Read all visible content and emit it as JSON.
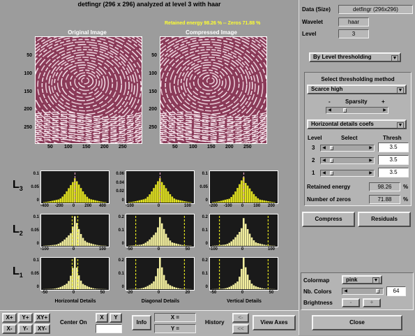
{
  "window": {
    "title": "detfingr (296 x 296) analyzed at level 3 with haar",
    "retained_info": "Retained energy 98.26 % -- Zeros 71.88 %"
  },
  "images": {
    "original_title": "Original Image",
    "compressed_title": "Compressed Image",
    "y_ticks": [
      "50",
      "100",
      "150",
      "200",
      "250"
    ],
    "x_ticks": [
      "50",
      "100",
      "150",
      "200",
      "250"
    ]
  },
  "histograms": {
    "row_labels": [
      {
        "letter": "L",
        "sub": "3"
      },
      {
        "letter": "L",
        "sub": "2"
      },
      {
        "letter": "L",
        "sub": "1"
      }
    ],
    "col_titles": [
      "Horizontal Details",
      "Diagonal Details",
      "Vertical Details"
    ],
    "rows": [
      {
        "cols": [
          {
            "yticks": [
              "0.1",
              "0.05",
              "0"
            ],
            "xticks": [
              "-400",
              "-200",
              "0",
              "200",
              "400"
            ],
            "color": "#e0e020"
          },
          {
            "yticks": [
              "0.06",
              "0.04",
              "0.02",
              "0"
            ],
            "xticks": [
              "-100",
              "0",
              "100"
            ],
            "color": "#e0e020"
          },
          {
            "yticks": [
              "0.1",
              "0.05",
              "0"
            ],
            "xticks": [
              "-200",
              "-100",
              "0",
              "100",
              "200"
            ],
            "color": "#e0e020"
          }
        ]
      },
      {
        "cols": [
          {
            "yticks": [
              "0.1",
              "0.05",
              "0"
            ],
            "xticks": [
              "-100",
              "0",
              "100"
            ],
            "color": "#f4f0a0"
          },
          {
            "yticks": [
              "0.2",
              "0.1",
              "0"
            ],
            "xticks": [
              "-50",
              "0",
              "50"
            ],
            "color": "#f4f0a0"
          },
          {
            "yticks": [
              "0.2",
              "0.1",
              "0"
            ],
            "xticks": [
              "-100",
              "0",
              "100"
            ],
            "color": "#f4f0a0"
          }
        ]
      },
      {
        "cols": [
          {
            "yticks": [
              "0.1",
              "0.05",
              "0"
            ],
            "xticks": [
              "-50",
              "0",
              "50"
            ],
            "color": "#f4f0a0"
          },
          {
            "yticks": [
              "0.2",
              "0.1",
              "0"
            ],
            "xticks": [
              "-20",
              "0",
              "20"
            ],
            "color": "#f4f0a0"
          },
          {
            "yticks": [
              "0.2",
              "0.1",
              "0"
            ],
            "xticks": [
              "-50",
              "0",
              "50"
            ],
            "color": "#f4f0a0"
          }
        ]
      }
    ]
  },
  "right_panel": {
    "data_label": "Data  (Size)",
    "data_value": "detfingr  (296x296)",
    "wavelet_label": "Wavelet",
    "wavelet_value": "haar",
    "level_label": "Level",
    "level_value": "3",
    "threshold_mode": "By Level thresholding",
    "select_method_title": "Select thresholding method",
    "method_value": "Scarce high",
    "sparsity_minus": "-",
    "sparsity_label": "Sparsity",
    "sparsity_plus": "+",
    "details_value": "Horizontal details coefs",
    "col_level": "Level",
    "col_select": "Select",
    "col_thresh": "Thresh",
    "levels": [
      {
        "level": "3",
        "thresh": "3.5"
      },
      {
        "level": "2",
        "thresh": "3.5"
      },
      {
        "level": "1",
        "thresh": "3.5"
      }
    ],
    "retained_label": "Retained energy",
    "retained_value": "98.26",
    "retained_unit": "%",
    "zeros_label": "Number of zeros",
    "zeros_value": "71.88",
    "zeros_unit": "%",
    "compress_label": "Compress",
    "residuals_label": "Residuals",
    "colormap_label": "Colormap",
    "colormap_value": "pink",
    "nbcolors_label": "Nb. Colors",
    "nbcolors_value": "64",
    "brightness_label": "Brightness",
    "close_label": "Close"
  },
  "bottom": {
    "xplus": "X+",
    "yplus": "Y+",
    "xyplus": "XY+",
    "xminus": "X-",
    "yminus": "Y-",
    "xyminus": "XY-",
    "center_on": "Center On",
    "x_btn": "X",
    "y_btn": "Y",
    "info": "Info",
    "x_eq": "X =",
    "y_eq": "Y =",
    "history": "History",
    "view_axes": "View Axes"
  }
}
